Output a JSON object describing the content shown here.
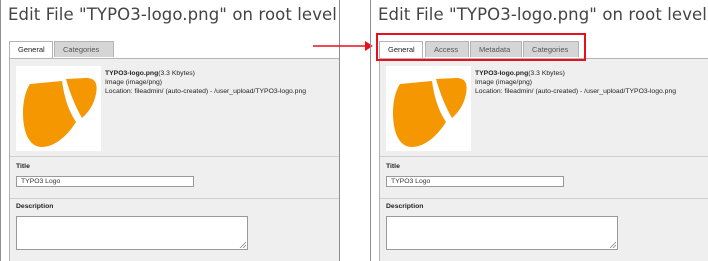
{
  "before": {
    "heading": "Edit File \"TYPO3-logo.png\" on root level",
    "tabs": [
      "General",
      "Categories"
    ],
    "active_tab": "General",
    "file": {
      "name": "TYPO3-logo.png",
      "size": "(3.3 Kbytes)",
      "type": "Image (image/png)",
      "location": "Location: fileadmin/ (auto-created) - /user_upload/TYPO3-logo.png"
    },
    "title_label": "Title",
    "title_value": "TYPO3 Logo",
    "description_label": "Description",
    "description_value": ""
  },
  "after": {
    "heading": "Edit File \"TYPO3-logo.png\" on root level",
    "tabs": [
      "General",
      "Access",
      "Metadata",
      "Categories"
    ],
    "active_tab": "General",
    "file": {
      "name": "TYPO3-logo.png",
      "size": "(3.3 Kbytes)",
      "type": "Image (image/png)",
      "location": "Location: fileadmin/ (auto-created) - /user_upload/TYPO3-logo.png"
    },
    "title_label": "Title",
    "title_value": "TYPO3 Logo",
    "description_label": "Description",
    "description_value": ""
  },
  "colors": {
    "logo": "#f49700",
    "callout": "#e8101c",
    "tab_inactive": "#d5d5d5",
    "panel_bg": "#efefef"
  },
  "icons": {
    "logo": "typo3-logo-icon",
    "arrow": "arrow-right-icon",
    "grip": "resize-grip-icon"
  }
}
